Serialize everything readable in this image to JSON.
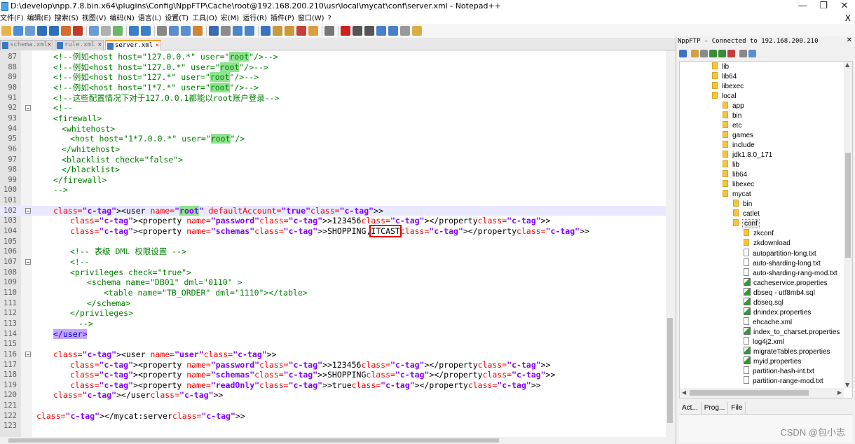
{
  "window": {
    "title": "D:\\develop\\npp.7.8.bin.x64\\plugins\\Config\\NppFTP\\Cache\\root@192.168.200.210\\usr\\local\\mycat\\conf\\server.xml - Notepad++",
    "minimize": "—",
    "maximize": "❐",
    "close": "✕"
  },
  "menu": {
    "items": [
      "文件(F)",
      "编辑(E)",
      "搜索(S)",
      "视图(V)",
      "编码(N)",
      "语言(L)",
      "设置(T)",
      "工具(O)",
      "宏(M)",
      "运行(R)",
      "插件(P)",
      "窗口(W)",
      "?"
    ],
    "close": "X"
  },
  "tabs": [
    {
      "label": "schema.xml",
      "active": false
    },
    {
      "label": "rule.xml",
      "active": false
    },
    {
      "label": "server.xml",
      "active": true
    }
  ],
  "editor": {
    "current_line": 102,
    "lines": [
      {
        "n": "87",
        "text": "<!--例如<host host=\"127.0.0.*\" user=\"root\"/>-->"
      },
      {
        "n": "88",
        "text": "<!--例如<host host=\"127.0.*\" user=\"root\"/>-->"
      },
      {
        "n": "89",
        "text": "<!--例如<host host=\"127.*\" user=\"root\"/>-->"
      },
      {
        "n": "90",
        "text": "<!--例如<host host=\"1*7.*\" user=\"root\"/>-->"
      },
      {
        "n": "91",
        "text": "<!--这些配置情况下对于127.0.0.1都能以root账户登录-->"
      },
      {
        "n": "92",
        "text": "<!--"
      },
      {
        "n": "93",
        "text": "<firewall>"
      },
      {
        "n": "94",
        "text": "<whitehost>"
      },
      {
        "n": "95",
        "text": "<host host=\"1*7.0.0.*\" user=\"root\"/>"
      },
      {
        "n": "96",
        "text": "</whitehost>"
      },
      {
        "n": "97",
        "text": "<blacklist check=\"false\">"
      },
      {
        "n": "98",
        "text": "</blacklist>"
      },
      {
        "n": "99",
        "text": "</firewall>"
      },
      {
        "n": "100",
        "text": "-->"
      },
      {
        "n": "101",
        "text": ""
      },
      {
        "n": "102",
        "text": "<user name=\"root\" defaultAccount=\"true\">"
      },
      {
        "n": "103",
        "text": "<property name=\"password\">123456</property>"
      },
      {
        "n": "104",
        "text": "<property name=\"schemas\">SHOPPING,ITCAST</property>"
      },
      {
        "n": "105",
        "text": ""
      },
      {
        "n": "106",
        "text": "<!-- 表级 DML 权限设置 -->"
      },
      {
        "n": "107",
        "text": "<!--"
      },
      {
        "n": "108",
        "text": "<privileges check=\"true\">"
      },
      {
        "n": "109",
        "text": "<schema name=\"DB01\" dml=\"0110\" >"
      },
      {
        "n": "110",
        "text": "<table name=\"TB_ORDER\" dml=\"1110\"></table>"
      },
      {
        "n": "111",
        "text": "</schema>"
      },
      {
        "n": "112",
        "text": "</privileges>"
      },
      {
        "n": "113",
        "text": "-->"
      },
      {
        "n": "114",
        "text": "</user>"
      },
      {
        "n": "115",
        "text": ""
      },
      {
        "n": "116",
        "text": "<user name=\"user\">"
      },
      {
        "n": "117",
        "text": "<property name=\"password\">123456</property>"
      },
      {
        "n": "118",
        "text": "<property name=\"schemas\">SHOPPING</property>"
      },
      {
        "n": "119",
        "text": "<property name=\"readOnly\">true</property>"
      },
      {
        "n": "120",
        "text": "</user>"
      },
      {
        "n": "121",
        "text": ""
      },
      {
        "n": "122",
        "text": "</mycat:server>"
      },
      {
        "n": "123",
        "text": ""
      }
    ]
  },
  "ftp": {
    "title": "NppFTP - Connected to 192.168.200.210",
    "close": "✕",
    "tree": [
      {
        "label": "lib",
        "type": "folder",
        "depth": 0
      },
      {
        "label": "lib64",
        "type": "folder",
        "depth": 0
      },
      {
        "label": "libexec",
        "type": "folder",
        "depth": 0
      },
      {
        "label": "local",
        "type": "folder",
        "depth": 0
      },
      {
        "label": "app",
        "type": "folder",
        "depth": 1
      },
      {
        "label": "bin",
        "type": "folder",
        "depth": 1
      },
      {
        "label": "etc",
        "type": "folder",
        "depth": 1
      },
      {
        "label": "games",
        "type": "folder",
        "depth": 1
      },
      {
        "label": "include",
        "type": "folder",
        "depth": 1
      },
      {
        "label": "jdk1.8.0_171",
        "type": "folder",
        "depth": 1
      },
      {
        "label": "lib",
        "type": "folder",
        "depth": 1
      },
      {
        "label": "lib64",
        "type": "folder",
        "depth": 1
      },
      {
        "label": "libexec",
        "type": "folder",
        "depth": 1
      },
      {
        "label": "mycat",
        "type": "folder",
        "depth": 1
      },
      {
        "label": "bin",
        "type": "folder",
        "depth": 2
      },
      {
        "label": "catlet",
        "type": "folder",
        "depth": 2
      },
      {
        "label": "conf",
        "type": "folder",
        "depth": 2,
        "selected": true
      },
      {
        "label": "zkconf",
        "type": "folder",
        "depth": 3
      },
      {
        "label": "zkdownload",
        "type": "folder",
        "depth": 3
      },
      {
        "label": "autopartition-long.txt",
        "type": "file",
        "depth": 3
      },
      {
        "label": "auto-sharding-long.txt",
        "type": "file",
        "depth": 3
      },
      {
        "label": "auto-sharding-rang-mod.txt",
        "type": "file",
        "depth": 3
      },
      {
        "label": "cacheservice.properties",
        "type": "prop",
        "depth": 3
      },
      {
        "label": "dbseq - utf8mb4.sql",
        "type": "prop",
        "depth": 3
      },
      {
        "label": "dbseq.sql",
        "type": "prop",
        "depth": 3
      },
      {
        "label": "dnindex.properties",
        "type": "prop",
        "depth": 3
      },
      {
        "label": "ehcache.xml",
        "type": "file",
        "depth": 3
      },
      {
        "label": "index_to_charset.properties",
        "type": "prop",
        "depth": 3
      },
      {
        "label": "log4j2.xml",
        "type": "file",
        "depth": 3
      },
      {
        "label": "migrateTables.properties",
        "type": "prop",
        "depth": 3
      },
      {
        "label": "myid.properties",
        "type": "prop",
        "depth": 3
      },
      {
        "label": "partition-hash-int.txt",
        "type": "file",
        "depth": 3
      },
      {
        "label": "partition-range-mod.txt",
        "type": "file",
        "depth": 3
      }
    ],
    "bottom_tabs": [
      "Act...",
      "Prog...",
      "File"
    ]
  },
  "watermark": "CSDN @包小志",
  "colors": {
    "comment": "#008000",
    "tag": "#0000ff",
    "attr": "#ff0000",
    "value": "#8000ff",
    "highlight_root": "#8fe38f",
    "highlight_tag": "#c6a6ff",
    "annotation_box": "#e00000"
  }
}
